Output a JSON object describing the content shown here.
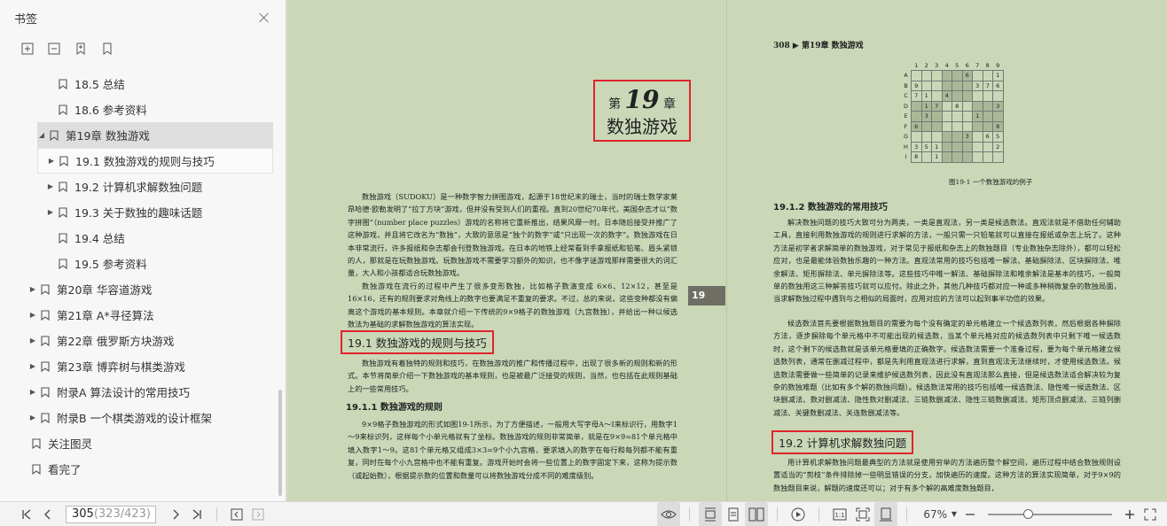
{
  "sidebar": {
    "title": "书签",
    "items": [
      {
        "label": "18.5   总结",
        "indent": 2,
        "caret": ""
      },
      {
        "label": "18.6   参考资料",
        "indent": 2,
        "caret": ""
      },
      {
        "label": "第19章   数独游戏",
        "indent": 1,
        "caret": "▲",
        "selected": true
      },
      {
        "label": "19.1   数独游戏的规则与技巧",
        "indent": 2,
        "caret": "▶",
        "hover": true
      },
      {
        "label": "19.2   计算机求解数独问题",
        "indent": 2,
        "caret": "▶"
      },
      {
        "label": "19.3   关于数独的趣味话题",
        "indent": 2,
        "caret": "▶"
      },
      {
        "label": "19.4   总结",
        "indent": 2,
        "caret": ""
      },
      {
        "label": "19.5   参考资料",
        "indent": 2,
        "caret": ""
      },
      {
        "label": "第20章   华容道游戏",
        "indent": 1,
        "caret": "▶"
      },
      {
        "label": "第21章   A*寻径算法",
        "indent": 1,
        "caret": "▶"
      },
      {
        "label": "第22章   俄罗斯方块游戏",
        "indent": 1,
        "caret": "▶"
      },
      {
        "label": "第23章   博弈树与棋类游戏",
        "indent": 1,
        "caret": "▶"
      },
      {
        "label": "附录A   算法设计的常用技巧",
        "indent": 1,
        "caret": "▶"
      },
      {
        "label": "附录B   一个棋类游戏的设计框架",
        "indent": 1,
        "caret": "▶"
      },
      {
        "label": "关注图灵",
        "indent": 0,
        "caret": ""
      },
      {
        "label": "看完了",
        "indent": 0,
        "caret": ""
      }
    ]
  },
  "left_page": {
    "chapter_prefix": "第",
    "chapter_num": "19",
    "chapter_suffix": "章",
    "chapter_title": "数独游戏",
    "tab": "19",
    "p1": "数独游戏（SUDOKU）是一种数字智力拼图游戏，起源于18世纪末的瑞士，当时的瑞士数学家莱昂哈德·欧勒发明了“拉丁方块”游戏，但并没有受到人们的重视。直到20世纪70年代，美国杂志才以“数字拼图”（number place puzzles）游戏的名称将它重新推出，结果风靡一时。日本随后接受并推广了这种游戏，并且将它改名为“数独”，大致的意思是“独个的数字”或“只出现一次的数字”。数独游戏在日本非常流行，许多报纸和杂志都会刊登数独游戏。在日本的地铁上经常看到手拿报纸和铅笔、眉头紧锁的人，那就是在玩数独游戏。玩数独游戏不需要学习额外的知识，也不像字谜游戏那样需要很大的词汇量，大人和小孩都适合玩数独游戏。",
    "p2": "数独游戏在流行的过程中产生了很多变形数独，比如格子数演变成 6×6、12×12，甚至是16×16，还有的规则要求对角线上的数字也要满足不重复的要求。不过，总的来说，这些变种都没有偏离这个游戏的基本规则。本章就介绍一下传统的9×9格子的数独游戏（九宫数独），并给出一种以候选数法为基础的求解数独游戏的算法实现。",
    "h1": "19.1   数独游戏的规则与技巧",
    "p3": "数独游戏有着独特的规则和技巧，在数独游戏的推广和传播过程中，出现了很多新的规则和新的形式。本节将简单介绍一下数独游戏的基本规则，也是被最广泛接受的规则，当然，也包括在此规则基础上的一些常用技巧。",
    "h2": "19.1.1   数独游戏的规则",
    "p4": "9×9格子数独游戏的形式如图19-1所示，为了方便描述，一般用大写字母A～I来标识行，用数字1～9来标识列，这样每个小单元格就有了坐标。数独游戏的规则非常简单，就是在9×9=81个单元格中填入数字1～9。这81个单元格又组成3×3=9个小九宫格，要求填入的数字在每行和每列都不能有重复，同时在每个小九宫格中也不能有重复。游戏开始时会将一些位置上的数字固定下来，这称为提示数（或起始数），根据提示数的位置和数量可以将数独游戏分成不同的难度级别。"
  },
  "right_page": {
    "running_head": "308  ▶ 第19章  数独游戏",
    "sudoku_cols": [
      "1",
      "2",
      "3",
      "4",
      "5",
      "6",
      "7",
      "8",
      "9"
    ],
    "sudoku_rows": [
      {
        "r": "A",
        "c": [
          "",
          "",
          "",
          "",
          "",
          "6",
          "",
          "",
          "1"
        ]
      },
      {
        "r": "B",
        "c": [
          "9",
          "",
          "",
          "",
          "",
          "",
          "3",
          "7",
          "6"
        ]
      },
      {
        "r": "C",
        "c": [
          "7",
          "1",
          "",
          "4",
          "",
          "",
          "",
          "",
          "",
          ""
        ]
      },
      {
        "r": "D",
        "c": [
          "",
          "1",
          "7",
          "",
          "8",
          "",
          "",
          "",
          "3"
        ]
      },
      {
        "r": "E",
        "c": [
          "",
          "3",
          "",
          "",
          "",
          "",
          "1",
          "",
          ""
        ]
      },
      {
        "r": "F",
        "c": [
          "6",
          "",
          "",
          "",
          "",
          "",
          "",
          "",
          "8"
        ]
      },
      {
        "r": "G",
        "c": [
          "",
          "",
          "",
          "",
          "",
          "3",
          "",
          "6",
          "5"
        ]
      },
      {
        "r": "H",
        "c": [
          "3",
          "5",
          "1",
          "",
          "",
          "",
          "",
          "",
          "2"
        ]
      },
      {
        "r": "I",
        "c": [
          "8",
          "",
          "1",
          "",
          "",
          "",
          "",
          "",
          ""
        ]
      }
    ],
    "fig_caption": "图19-1   一个数独游戏的例子",
    "h1": "19.1.2   数独游戏的常用技巧",
    "p1": "解决数独问题的技巧大致可分为两类，一类是直观法，另一类是候选数法。直观法就是不借助任何辅助工具，直接利用数独游戏的规则进行求解的方法，一般只需一只铅笔就可以直接在报纸或杂志上玩了。这种方法是初学者求解简单的数独游戏，对于常见于报纸和杂志上的数独题目（专业数独杂志除外），都可以轻松应对，也是最能体验数独乐趣的一种方法。直观法常用的技巧包括唯一解法、基础摒除法、区块摒除法、唯余解法、矩形摒除法、单元摒除法等。这些技巧中唯一解法、基础摒除法和唯余解法是基本的技巧，一般简单的数独用这三种解答技巧就可以应付。除此之外，其他几种技巧都对应一种或多种稍微复杂的数独局面，当求解数独过程中遇到与之相似的局面时，应用对应的方法可以起到事半功倍的效果。",
    "p2": "候选数法首先要根据数独题目的需要为每个没有确定的单元格建立一个候选数列表，然后根据各种摒除方法，逐步摒除每个单元格中不可能出现的候选数，当某个单元格对应的候选数列表中只剩下唯一候选数时，这个剩下的候选数就是该单元格要填的正确数字。候选数法需要一个准备过程，要为每个单元格建立候选数列表，通常在删减过程中，都是先利用直观法进行求解，直到直观法无法继续时，才使用候选数法。候选数法需要做一些简单的记录来维护候选数列表，因此没有直观法那么直接，但是候选数法适合解决较为复杂的数独难题（比如有多个解的数独问题）。候选数法常用的技巧包括唯一候选数法、隐性唯一候选数法、区块删减法、数对删减法、隐性数对删减法、三链数删减法、隐性三链数删减法、矩形顶点删减法、三链列删减法、关键数删减法、关连数删减法等。",
    "h2": "19.2   计算机求解数独问题",
    "p3": "用计算机求解数独问题最典型的方法就是使用穷举的方法遍历整个解空间，遍历过程中结合数独规则设置适当的“剪枝”条件排除掉一些明显错误的分支，加快遍历的速度。这种方法的算法实现简单，对于9×9的数独题目来说，解题的速度还可以；对于有多个解的高难度数独题目，"
  },
  "toolbar": {
    "page_current": "305",
    "page_total": " (323/423)",
    "zoom": "67%"
  }
}
